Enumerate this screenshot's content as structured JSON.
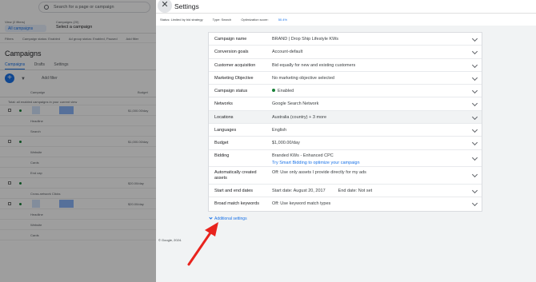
{
  "background": {
    "search_placeholder": "Search for a page or campaign",
    "view_label": "View (2 filters)",
    "all_campaigns": "All campaigns",
    "campaign_selector_label": "Campaigns (20)",
    "campaign_selector": "Select a campaign",
    "filters": [
      "Filters",
      "Campaign status: Enabled",
      "Ad group status: Enabled, Paused",
      "Add filter"
    ],
    "heading": "Campaigns",
    "tabs": [
      "Campaigns",
      "Drafts",
      "Settings"
    ],
    "add_filter": "Add filter",
    "col_campaign": "Campaign",
    "col_budget": "Budget",
    "total_text": "Total: all enabled campaigns in your current view",
    "rows": [
      {
        "text": "",
        "amount": "$1,000.00/day",
        "dot": true,
        "thumbs": true
      },
      {
        "text": "Headline",
        "amount": ""
      },
      {
        "text": "Search",
        "amount": ""
      },
      {
        "text": "",
        "amount": "$1,000.00/day",
        "dot": true
      },
      {
        "text": "Website",
        "amount": ""
      },
      {
        "text": "Cards",
        "amount": ""
      },
      {
        "text": "End cap",
        "amount": ""
      },
      {
        "text": "",
        "amount": "$20.00/day",
        "dot": true
      },
      {
        "text": "Cross-network Clicks",
        "amount": ""
      },
      {
        "text": "",
        "amount": "$20.00/day",
        "dot": true,
        "thumbs": true
      },
      {
        "text": "Headline",
        "amount": ""
      },
      {
        "text": "Website",
        "amount": ""
      },
      {
        "text": "Cards",
        "amount": ""
      }
    ]
  },
  "panel": {
    "title": "Settings",
    "close_icon": "close-icon",
    "status_text": "Status: Limited by bid strategy",
    "type_text": "Type: Search",
    "optimization_label": "Optimization score:",
    "optimization_value": "50.4%",
    "settings": [
      {
        "label": "Campaign name",
        "value": "BRAND | Drop Ship Lifestyle KWs"
      },
      {
        "label": "Conversion goals",
        "value": "Account-default"
      },
      {
        "label": "Customer acquisition",
        "value": "Bid equally for new and existing customers"
      },
      {
        "label": "Marketing Objective",
        "value": "No marketing objective selected"
      },
      {
        "label": "Campaign status",
        "value": "Enabled",
        "status_dot": true
      },
      {
        "label": "Networks",
        "value": "Google Search Network"
      },
      {
        "label": "Locations",
        "value": "Australia (country) + 3 more",
        "highlight": true
      },
      {
        "label": "Languages",
        "value": "English"
      },
      {
        "label": "Budget",
        "value": "$1,000.00/day"
      },
      {
        "label": "Bidding",
        "value": "Branded KWs - Enhanced CPC",
        "link": "Try Smart Bidding to optimize your campaign",
        "tall": true
      },
      {
        "label": "Automatically created assets",
        "value": "Off: Use only assets I provide directly for my ads",
        "tall": true
      },
      {
        "label": "Start and end dates",
        "value": "Start date: August 20, 2017",
        "value_b": "End date: Not set"
      },
      {
        "label": "Broad match keywords",
        "value": "Off: Use keyword match types"
      }
    ],
    "additional_settings": "Additional settings",
    "footer": "© Google, 2024."
  },
  "colors": {
    "accent": "#1a73e8",
    "status_green": "#188038",
    "arrow_red": "#e8231d",
    "overlay": "#5f6062"
  }
}
